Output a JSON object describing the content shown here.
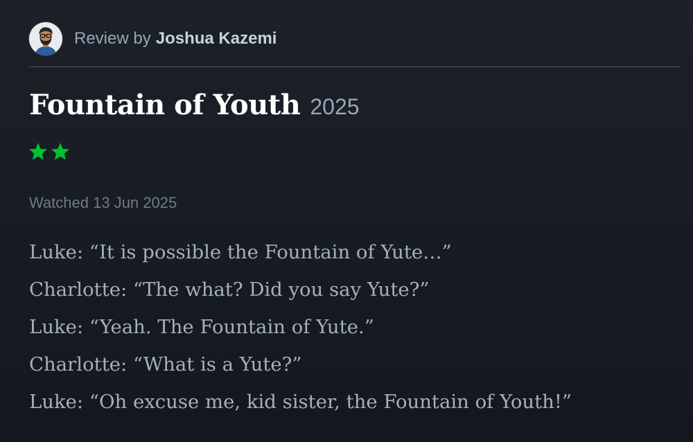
{
  "header": {
    "prefix": "Review by",
    "author": "Joshua Kazemi",
    "avatar_icon": "user-avatar"
  },
  "film": {
    "title": "Fountain of Youth",
    "year": "2025"
  },
  "rating": {
    "stars": 2,
    "color": "#00c030",
    "icon": "star-icon"
  },
  "watched": "Watched 13 Jun 2025",
  "review": {
    "lines": [
      "Luke: “It is possible the Fountain of Yute…”",
      "Charlotte: “The what? Did you say Yute?”",
      "Luke: “Yeah. The Fountain of Yute.”",
      "Charlotte: “What is a Yute?”",
      "Luke: “Oh excuse me, kid sister, the Fountain of Youth!”"
    ]
  },
  "colors": {
    "background": "#1a1e25",
    "title": "#ffffff",
    "muted": "#97a6b6",
    "body_text": "#a4b1be",
    "accent_green": "#00c030"
  }
}
